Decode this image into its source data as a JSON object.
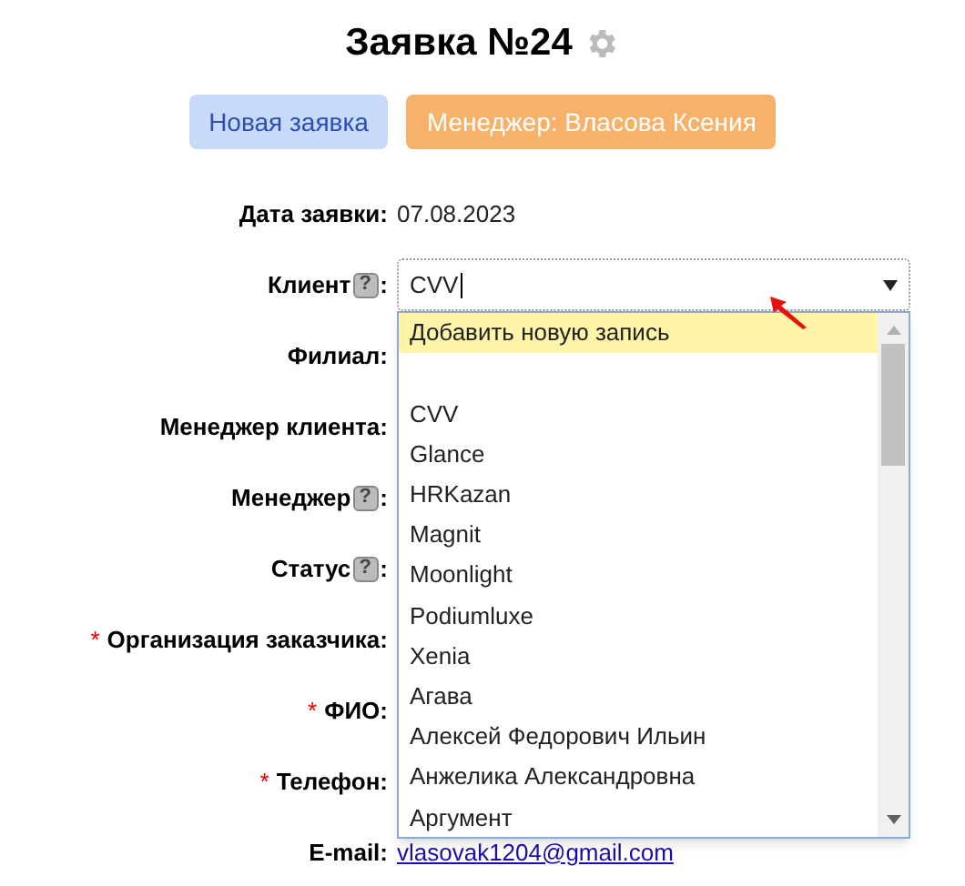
{
  "title": "Заявка №24",
  "badges": [
    {
      "label": "Новая заявка",
      "kind": "status"
    },
    {
      "label": "Менеджер: Власова Ксения",
      "kind": "manager"
    }
  ],
  "fields": [
    {
      "label": "Дата заявки:",
      "kind": "text",
      "value": "07.08.2023"
    },
    {
      "label": "Клиент",
      "help": "?",
      "colon": ":",
      "kind": "select",
      "value": "CVV"
    },
    {
      "label": "Филиал:",
      "kind": "empty"
    },
    {
      "label": "Менеджер клиента:",
      "kind": "empty"
    },
    {
      "label": "Менеджер",
      "help": "?",
      "colon": ":",
      "kind": "empty"
    },
    {
      "label": "Статус",
      "help": "?",
      "colon": ":",
      "kind": "empty"
    },
    {
      "mark": "*",
      "label": "Организация заказчика:",
      "kind": "empty"
    },
    {
      "mark": "*",
      "label": "ФИО:",
      "kind": "empty"
    },
    {
      "mark": "*",
      "label": "Телефон:",
      "kind": "empty"
    },
    {
      "label": "E-mail:",
      "kind": "link",
      "value": "vlasovak1204@gmail.com"
    }
  ],
  "dropdown": [
    {
      "kind": "option",
      "label": "Добавить новую запись",
      "selected": true
    },
    {
      "kind": "blank",
      "selected": false
    },
    {
      "kind": "option",
      "label": "CVV",
      "selected": false
    },
    {
      "kind": "option",
      "label": "Glance",
      "selected": false
    },
    {
      "kind": "option",
      "label": "HRKazan",
      "selected": false
    },
    {
      "kind": "option",
      "label": "Magnit",
      "selected": false
    },
    {
      "kind": "option",
      "label": "Moonlight",
      "selected": false
    },
    {
      "kind": "option",
      "label": "Podiumluxe",
      "selected": false
    },
    {
      "kind": "option",
      "label": "Xenia",
      "selected": false
    },
    {
      "kind": "option",
      "label": "Агава",
      "selected": false
    },
    {
      "kind": "option",
      "label": "Алексей Федорович Ильин",
      "selected": false
    },
    {
      "kind": "option",
      "label": "Анжелика Александровна",
      "selected": false
    },
    {
      "kind": "option",
      "label": "Аргумент",
      "selected": false
    }
  ]
}
